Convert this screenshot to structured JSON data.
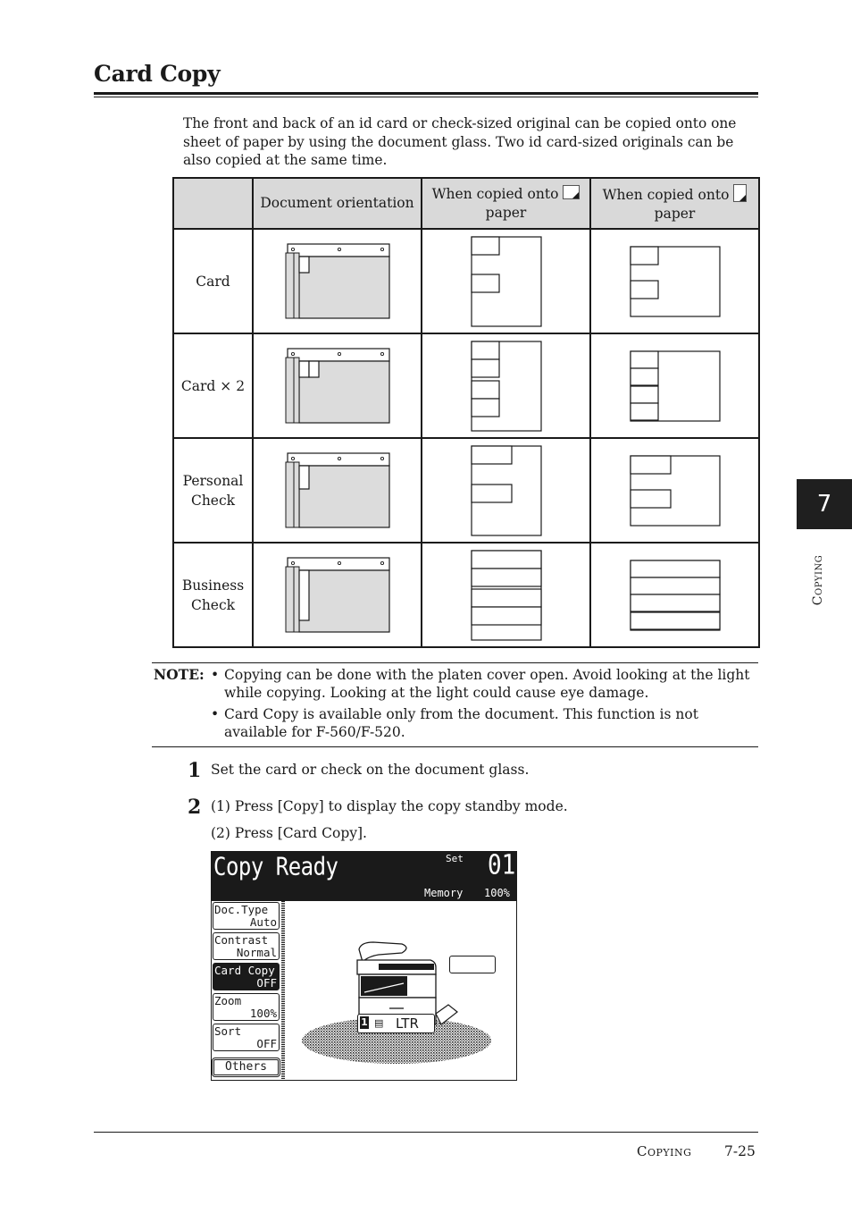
{
  "page": {
    "title": "Card Copy",
    "intro": "The front and back of an id card or check-sized original can be copied onto one sheet of paper by using the document glass. Two id card-sized originals can be also copied at the same time.",
    "table": {
      "headers": [
        "",
        "Document orientation",
        "When copied onto",
        "When copied onto"
      ],
      "header_suffix": "paper",
      "header_icons": [
        "landscape-paper-icon",
        "portrait-paper-icon"
      ],
      "rows": [
        {
          "label_lines": [
            "Card"
          ]
        },
        {
          "label_lines": [
            "Card × 2"
          ]
        },
        {
          "label_lines": [
            "Personal",
            "Check"
          ]
        },
        {
          "label_lines": [
            "Business",
            "Check"
          ]
        }
      ]
    },
    "note": {
      "label": "NOTE:",
      "bullets": [
        "Copying can be done with the platen cover open. Avoid looking at the light while copying. Looking at the light could cause eye damage.",
        "Card Copy is available only from the document. This function is not available for F-560/F-520."
      ]
    },
    "steps": [
      {
        "num": "1",
        "lines": [
          "Set the card or check on the document glass."
        ]
      },
      {
        "num": "2",
        "lines": [
          "(1) Press [Copy] to display the copy standby mode.",
          "(2) Press [Card Copy]."
        ]
      }
    ],
    "lcd": {
      "title": "Copy Ready",
      "set_label": "Set",
      "set_value": "01",
      "memory_label": "Memory",
      "memory_value": "100%",
      "softkeys": [
        {
          "label": "Doc.Type",
          "value": "Auto",
          "selected": false
        },
        {
          "label": "Contrast",
          "value": "Normal",
          "selected": false
        },
        {
          "label": "Card Copy",
          "value": "OFF",
          "selected": true
        },
        {
          "label": "Zoom",
          "value": "100%",
          "selected": false
        },
        {
          "label": "Sort",
          "value": "OFF",
          "selected": false
        }
      ],
      "others_label": "Others",
      "tray_number": "1",
      "paper_size": "LTR"
    },
    "side_tab": {
      "chapter": "7",
      "section": "Copying"
    },
    "footer": {
      "section": "Copying",
      "page": "7-25"
    }
  }
}
